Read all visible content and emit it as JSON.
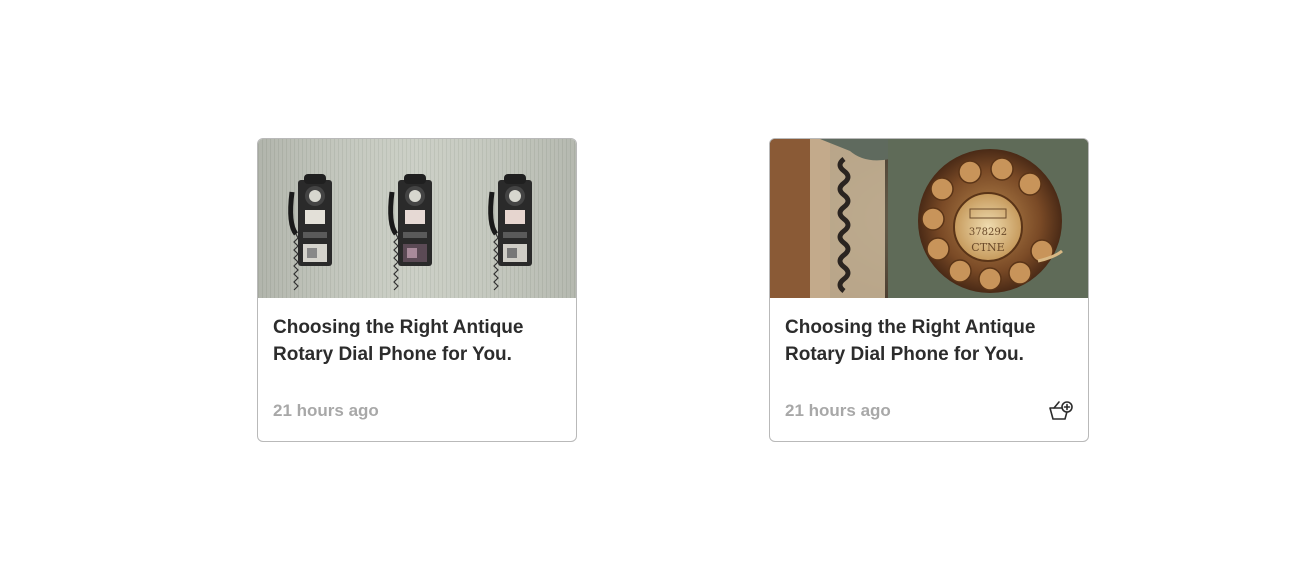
{
  "cards": [
    {
      "title": "Choosing the Right Antique Rotary Dial Phone for You.",
      "time": "21 hours ago",
      "image": "three-wall-payphones",
      "has_basket_action": false
    },
    {
      "title": "Choosing the Right Antique Rotary Dial Phone for You.",
      "time": "21 hours ago",
      "image": "rotary-dial-closeup",
      "has_basket_action": true,
      "basket_icon": "basket-add-icon"
    }
  ],
  "colors": {
    "title": "#2c2c2c",
    "time": "#a8a8a8",
    "border": "#b9b9b9"
  }
}
